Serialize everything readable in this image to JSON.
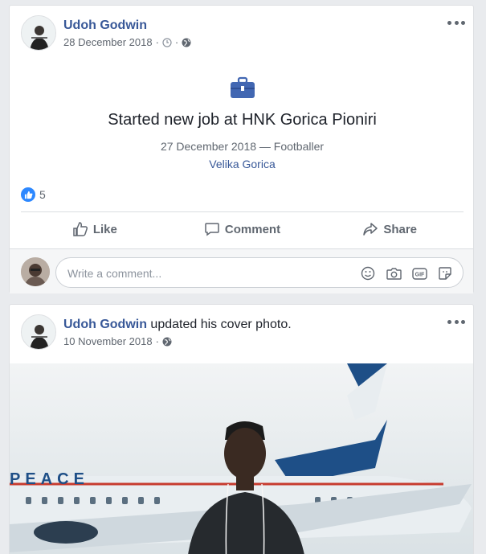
{
  "post1": {
    "author": "Udoh Godwin",
    "date": "28 December 2018",
    "meta_separator": "·",
    "job_title": "Started new job at HNK Gorica Pioniri",
    "job_subtitle": "27 December 2018 — Footballer",
    "job_location": "Velika Gorica",
    "reaction_count": "5",
    "actions": {
      "like": "Like",
      "comment": "Comment",
      "share": "Share"
    },
    "comment_placeholder": "Write a comment..."
  },
  "post2": {
    "author": "Udoh Godwin",
    "headline_rest": " updated his cover photo.",
    "date": "10 November 2018",
    "meta_separator": "·",
    "cover_text": "PEACE"
  },
  "icons": {
    "more": "more-options-icon",
    "clock": "clock-icon",
    "globe": "globe-icon",
    "briefcase": "briefcase-icon",
    "like_reaction": "like-reaction-icon",
    "thumb": "thumbs-up-icon",
    "comment": "comment-bubble-icon",
    "share": "share-arrow-icon",
    "emoji": "emoji-icon",
    "camera": "camera-icon",
    "gif": "gif-icon",
    "sticker": "sticker-icon"
  },
  "colors": {
    "link": "#385898",
    "like_blue": "#2d88ff",
    "muted": "#606770",
    "briefcase": "#4267b2"
  }
}
